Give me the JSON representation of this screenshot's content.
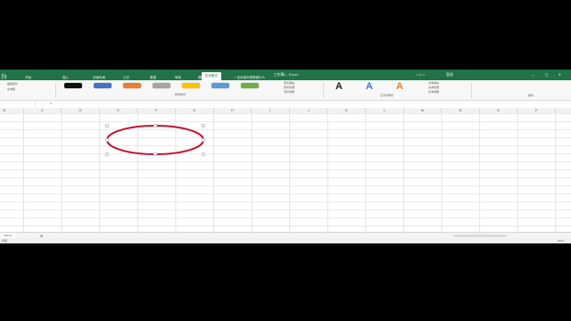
{
  "titlebar": {
    "app_name": "EL-",
    "window_title": "工作簿1 - Excel",
    "right_icons": "♪ ▭ ⌂",
    "right_label": "登录",
    "window_buttons": "—  ▢  ✕"
  },
  "tabs": [
    {
      "label": "文件"
    },
    {
      "label": "开始"
    },
    {
      "label": "插入"
    },
    {
      "label": "页面布局"
    },
    {
      "label": "公式"
    },
    {
      "label": "数据"
    },
    {
      "label": "审阅"
    },
    {
      "label": "视图"
    },
    {
      "label": "形状格式"
    },
    {
      "label": "♀ 告诉我你想要做什么"
    }
  ],
  "ribbon": {
    "group_styles_label": "形状样式",
    "group_wordart_label": "艺术字样式",
    "group_arrange_label": "排列",
    "shape_fill": "形状填充",
    "shape_outline": "形状轮廓",
    "shape_effects": "形状效果",
    "text_fill": "文本填充",
    "text_outline": "文本轮廓",
    "text_effects": "文本效果",
    "left_cmds": [
      "编辑形状",
      "文本框"
    ],
    "swatches": [
      {
        "name": "style-black",
        "color": "#111111"
      },
      {
        "name": "style-blue",
        "color": "#4472c4"
      },
      {
        "name": "style-orange",
        "color": "#ed7d31"
      },
      {
        "name": "style-gray",
        "color": "#a5a5a5"
      },
      {
        "name": "style-yellow",
        "color": "#ffc000"
      },
      {
        "name": "style-lightblue",
        "color": "#5b9bd5"
      },
      {
        "name": "style-green",
        "color": "#70ad47"
      }
    ],
    "wordart_letters": [
      "A",
      "A",
      "A"
    ]
  },
  "formula_bar": {
    "name_box": "",
    "fx": "fx"
  },
  "columns": [
    "B",
    "C",
    "D",
    "E",
    "F",
    "G",
    "H",
    "I",
    "J",
    "K",
    "L",
    "M",
    "N",
    "O",
    "P"
  ],
  "shape": {
    "type": "ellipse",
    "stroke_color": "#c8102e",
    "selected": true
  },
  "sheetbar": {
    "sheet_name": "Sheet1",
    "add": "⊕"
  },
  "statusbar": {
    "status": "就绪",
    "zoom": "100%"
  }
}
